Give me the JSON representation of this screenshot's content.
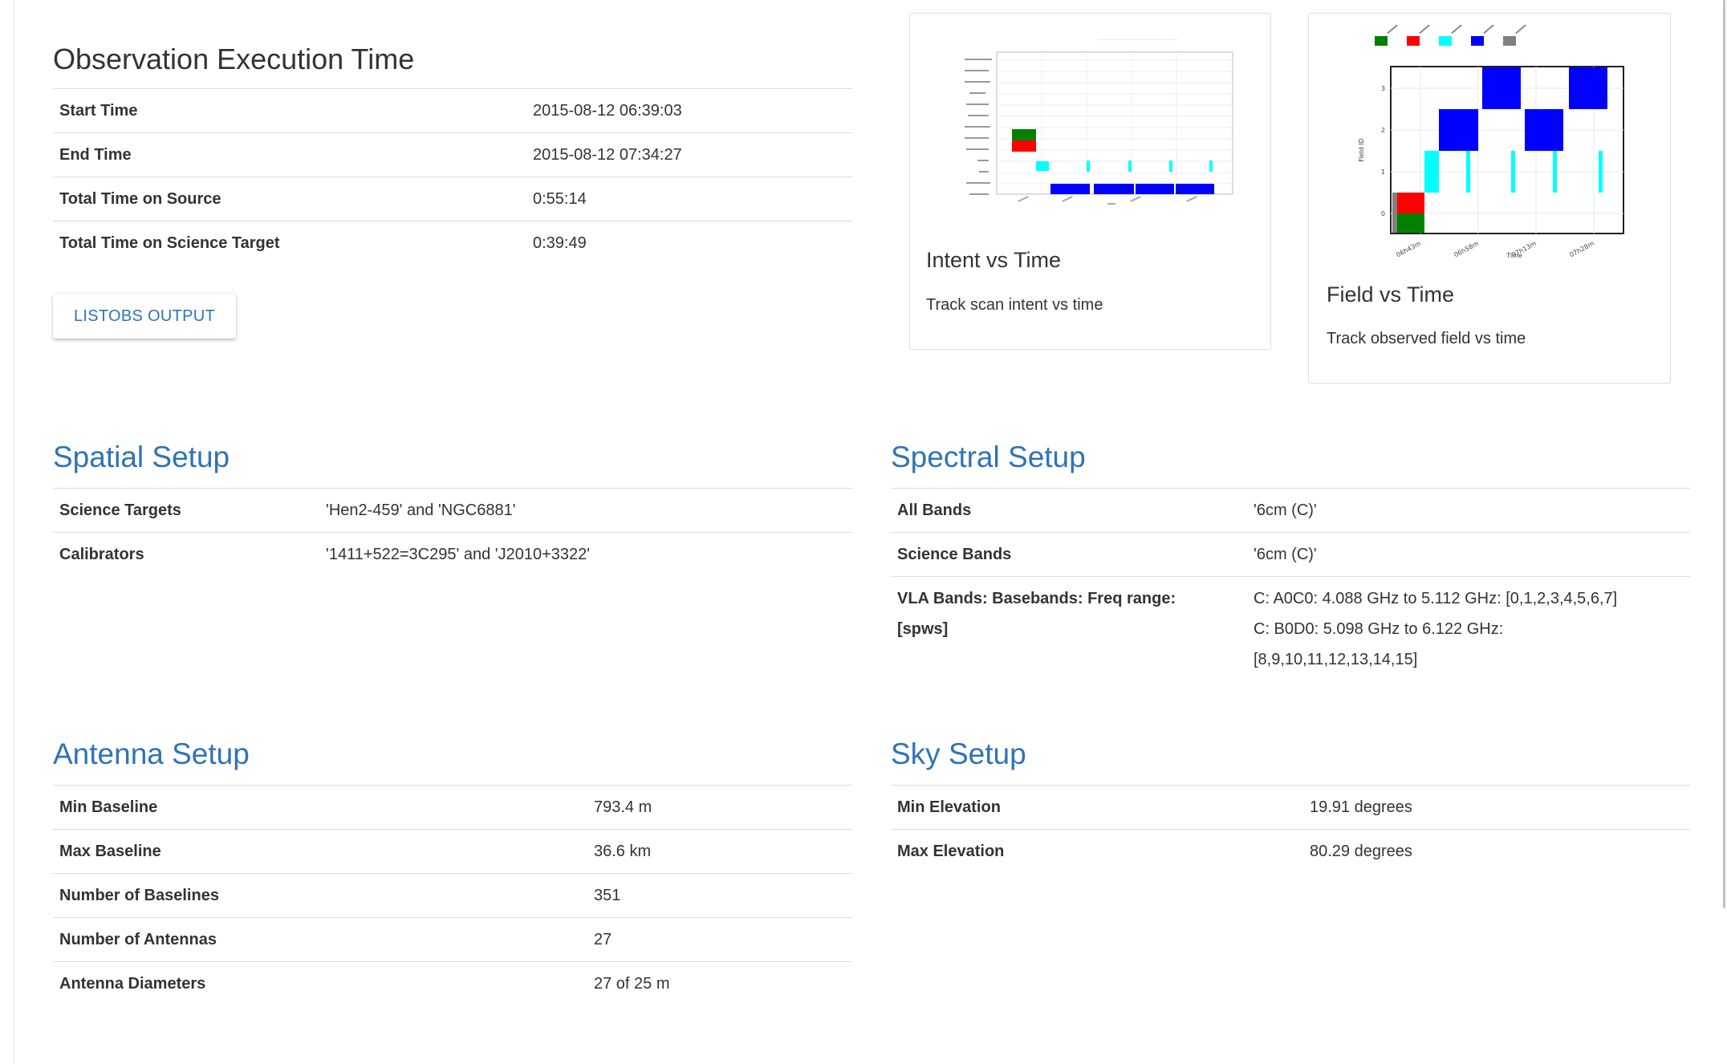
{
  "execution": {
    "title": "Observation Execution Time",
    "rows": [
      {
        "key": "Start Time",
        "value": "2015-08-12 06:39:03"
      },
      {
        "key": "End Time",
        "value": "2015-08-12 07:34:27"
      },
      {
        "key": "Total Time on Source",
        "value": "0:55:14"
      },
      {
        "key": "Total Time on Science Target",
        "value": "0:39:49"
      }
    ],
    "button_label": "LISTOBS OUTPUT"
  },
  "cards": {
    "intent": {
      "title": "Intent vs Time",
      "text": "Track scan intent vs time",
      "colors": {
        "green": "#008000",
        "red": "#ff0000",
        "cyan": "#00ffff",
        "blue": "#0000ff"
      }
    },
    "field": {
      "title": "Field vs Time",
      "text": "Track observed field vs time",
      "ylabel": "Field ID",
      "xlabel": "Time",
      "yticks": [
        "0",
        "1",
        "2",
        "3"
      ],
      "xticks": [
        "06h43m",
        "06h58m",
        "07h13m",
        "07h28m"
      ],
      "colors": {
        "green": "#008000",
        "red": "#ff0000",
        "cyan": "#00ffff",
        "blue": "#0000ff",
        "gray": "#808080"
      }
    }
  },
  "spatial": {
    "title": "Spatial Setup",
    "rows": [
      {
        "key": "Science Targets",
        "value": "'Hen2-459' and 'NGC6881'"
      },
      {
        "key": "Calibrators",
        "value": "'1411+522=3C295' and 'J2010+3322'"
      }
    ]
  },
  "spectral": {
    "title": "Spectral Setup",
    "rows": [
      {
        "key": "All Bands",
        "value": "'6cm (C)'"
      },
      {
        "key": "Science Bands",
        "value": "'6cm (C)'"
      }
    ],
    "vla": {
      "key_line1": "VLA Bands: Basebands: Freq range:",
      "key_line2": "[spws]",
      "value_line1": "C: A0C0: 4.088 GHz to 5.112 GHz: [0,1,2,3,4,5,6,7]",
      "value_line2": "C: B0D0: 5.098 GHz to 6.122 GHz:",
      "value_line3": "[8,9,10,11,12,13,14,15]"
    }
  },
  "antenna": {
    "title": "Antenna Setup",
    "rows": [
      {
        "key": "Min Baseline",
        "value": "793.4 m"
      },
      {
        "key": "Max Baseline",
        "value": "36.6 km"
      },
      {
        "key": "Number of Baselines",
        "value": "351"
      },
      {
        "key": "Number of Antennas",
        "value": "27"
      },
      {
        "key": "Antenna Diameters",
        "value": "27 of 25 m"
      }
    ]
  },
  "sky": {
    "title": "Sky Setup",
    "rows": [
      {
        "key": "Min Elevation",
        "value": "19.91 degrees"
      },
      {
        "key": "Max Elevation",
        "value": "80.29 degrees"
      }
    ]
  }
}
